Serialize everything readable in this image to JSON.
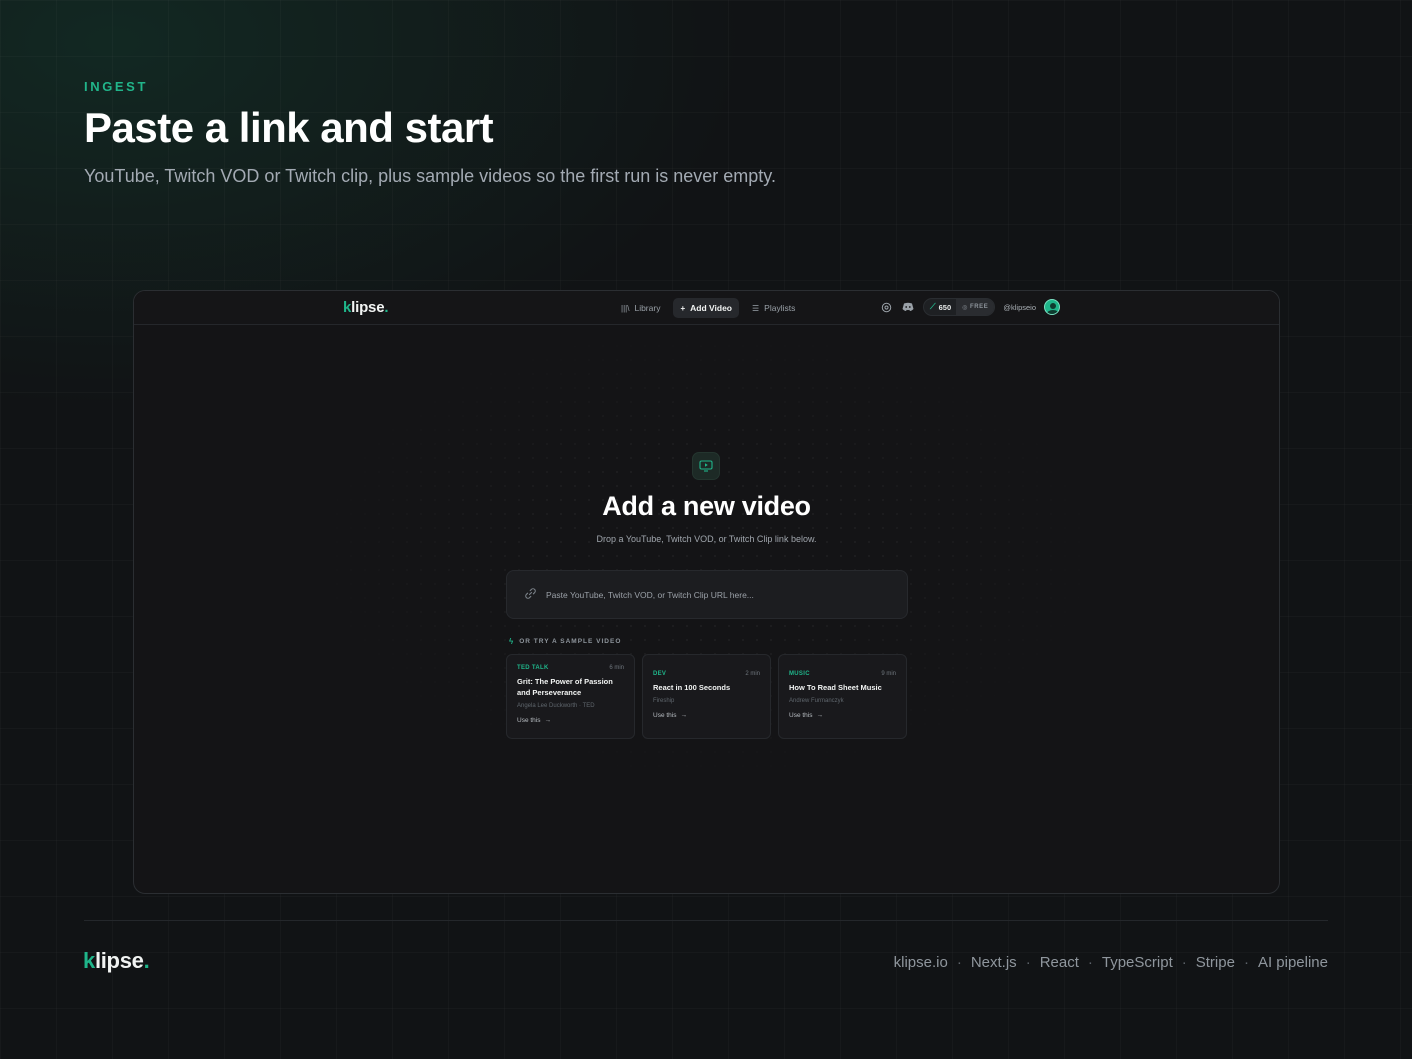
{
  "header": {
    "eyebrow": "INGEST",
    "title": "Paste a link and start",
    "subtitle": "YouTube, Twitch VOD or Twitch clip, plus sample videos so the first run is never empty."
  },
  "app": {
    "logo": {
      "k": "k",
      "rest": "lipse",
      "dot": "."
    },
    "nav": [
      {
        "label": "Library",
        "icon": "library-icon"
      },
      {
        "label": "Add Video",
        "icon": "plus-icon",
        "active": true
      },
      {
        "label": "Playlists",
        "icon": "playlist-icon"
      }
    ],
    "tools": {
      "settings_icon": "settings-icon",
      "discord_icon": "discord-icon"
    },
    "credits": {
      "count": "650",
      "plan": "FREE"
    },
    "user": {
      "handle": "@klipseio"
    },
    "main": {
      "title": "Add a new video",
      "subtitle": "Drop a YouTube, Twitch VOD, or Twitch Clip link below.",
      "input_placeholder": "Paste YouTube, Twitch VOD, or Twitch Clip URL here...",
      "sample_label": "OR TRY A SAMPLE VIDEO",
      "samples": [
        {
          "category": "TED TALK",
          "duration": "6 min",
          "title": "Grit: The Power of Passion and Perseverance",
          "author": "Angela Lee Duckworth · TED",
          "cta": "Use this"
        },
        {
          "category": "DEV",
          "duration": "2 min",
          "title": "React in 100 Seconds",
          "author": "Fireship",
          "cta": "Use this"
        },
        {
          "category": "MUSIC",
          "duration": "9 min",
          "title": "How To Read Sheet Music",
          "author": "Andrew Furmanczyk",
          "cta": "Use this"
        }
      ]
    }
  },
  "footer": {
    "logo": {
      "k": "k",
      "rest": "lipse",
      "dot": "."
    },
    "links": [
      "klipse.io",
      "Next.js",
      "React",
      "TypeScript",
      "Stripe",
      "AI pipeline"
    ]
  },
  "colors": {
    "accent": "#1fb58a",
    "background": "#111315",
    "window": "#141416"
  }
}
